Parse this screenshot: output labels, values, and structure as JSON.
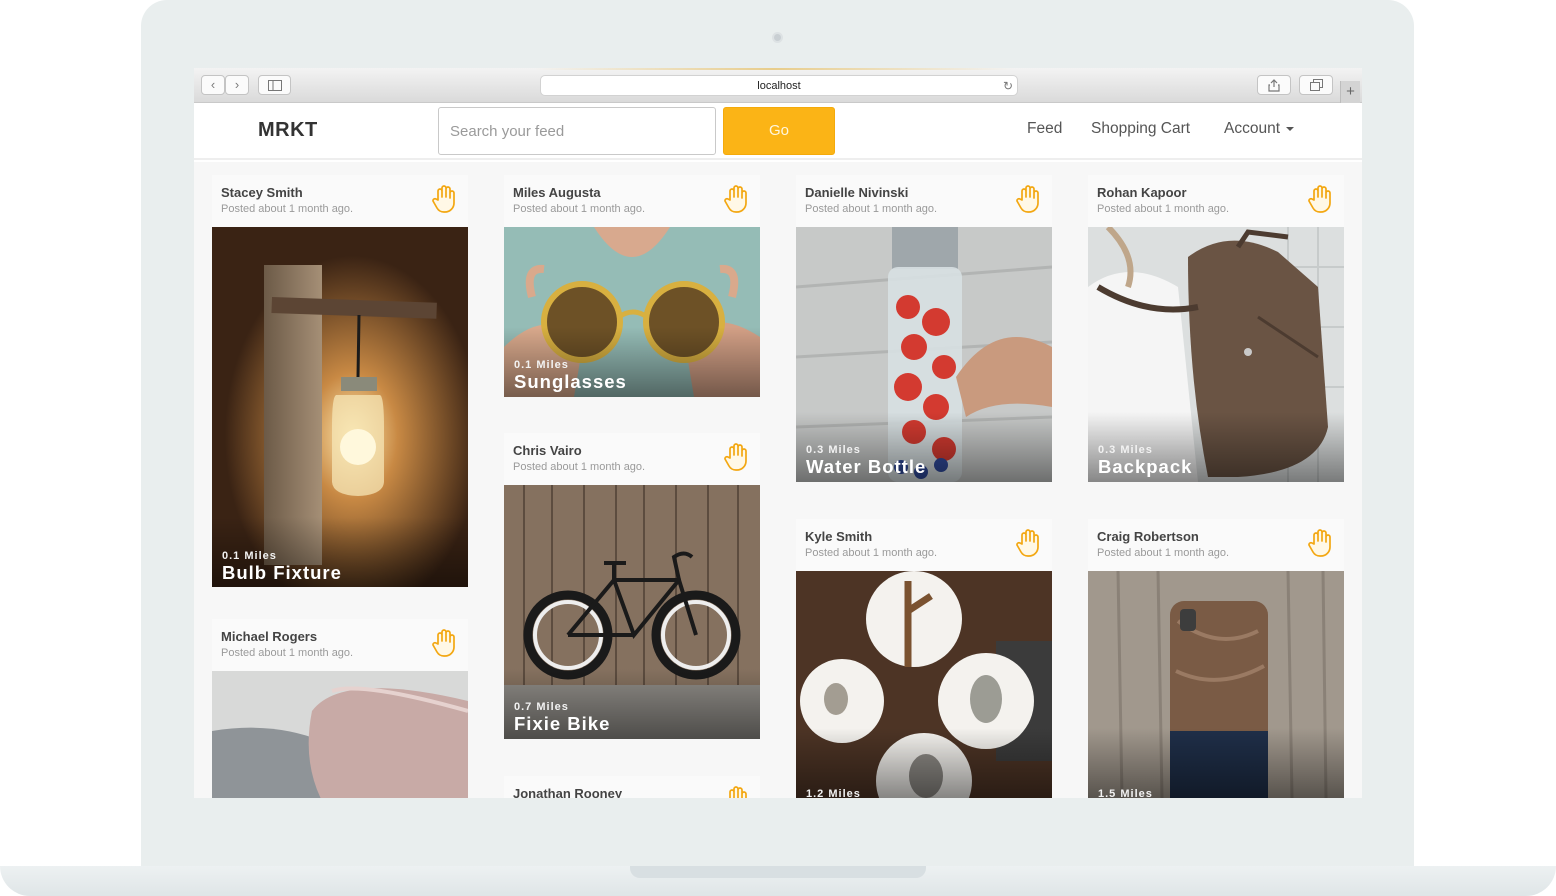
{
  "browser": {
    "url": "localhost",
    "back_glyph": "‹",
    "forward_glyph": "›",
    "new_tab_glyph": "+"
  },
  "navbar": {
    "brand": "MRKT",
    "search_placeholder": "Search your feed",
    "go_label": "Go",
    "links": {
      "feed": "Feed",
      "cart": "Shopping Cart",
      "account": "Account"
    }
  },
  "accent_color": "#fbb416",
  "feed": {
    "cards": [
      {
        "user": "Stacey Smith",
        "posted": "Posted about 1 month ago.",
        "distance": "0.1 Miles",
        "title": "Bulb Fixture",
        "photo": "mason-jar-wall-lamp"
      },
      {
        "user": "Michael Rogers",
        "posted": "Posted about 1 month ago.",
        "distance": "",
        "title": "",
        "photo": "pillows-on-bed"
      },
      {
        "user": "Miles Augusta",
        "posted": "Posted about 1 month ago.",
        "distance": "0.1 Miles",
        "title": "Sunglasses",
        "photo": "round-sunglasses"
      },
      {
        "user": "Chris Vairo",
        "posted": "Posted about 1 month ago.",
        "distance": "0.7 Miles",
        "title": "Fixie Bike",
        "photo": "fixie-bicycle"
      },
      {
        "user": "Jonathan Rooney",
        "posted": "",
        "distance": "",
        "title": "",
        "photo": ""
      },
      {
        "user": "Danielle Nivinski",
        "posted": "Posted about 1 month ago.",
        "distance": "0.3 Miles",
        "title": "Water Bottle",
        "photo": "infuser-water-bottle"
      },
      {
        "user": "Kyle Smith",
        "posted": "Posted about 1 month ago.",
        "distance": "1.2 Miles",
        "title": "",
        "photo": "owl-plates"
      },
      {
        "user": "Rohan Kapoor",
        "posted": "Posted about 1 month ago.",
        "distance": "0.3 Miles",
        "title": "Backpack",
        "photo": "brown-backpack"
      },
      {
        "user": "Craig Robertson",
        "posted": "Posted about 1 month ago.",
        "distance": "1.5 Miles",
        "title": "",
        "photo": "wood-phone-case"
      }
    ]
  }
}
